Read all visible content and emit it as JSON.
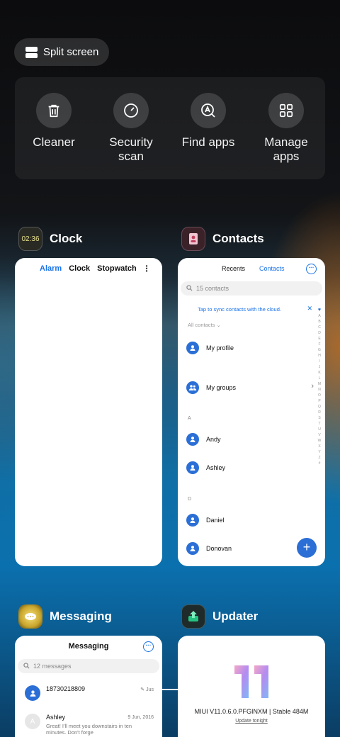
{
  "split_screen": {
    "label": "Split screen"
  },
  "quick_actions": [
    {
      "label": "Cleaner",
      "icon": "trash-icon"
    },
    {
      "label": "Security\nscan",
      "icon": "security-scan-icon"
    },
    {
      "label": "Find apps",
      "icon": "find-apps-icon"
    },
    {
      "label": "Manage\napps",
      "icon": "grid-icon"
    }
  ],
  "apps": {
    "clock": {
      "title": "Clock",
      "icon_text": "02:36",
      "tabs": [
        "Alarm",
        "Clock",
        "Stopwatch"
      ],
      "active_tab": "Alarm"
    },
    "contacts": {
      "title": "Contacts",
      "tabs": [
        "Recents",
        "Contacts"
      ],
      "active_tab": "Contacts",
      "search_placeholder": "15 contacts",
      "sync_notice": "Tap to sync contacts with the cloud.",
      "filter": "All contacts",
      "my_profile": "My profile",
      "my_groups": "My groups",
      "sections": [
        {
          "letter": "A",
          "names": [
            "Andy",
            "Ashley"
          ]
        },
        {
          "letter": "D",
          "names": [
            "Daniel",
            "Donovan"
          ]
        }
      ],
      "alphabet": "ABCDEFGHIJKLMNOPQRSTUVWXYZ#"
    },
    "messaging": {
      "title": "Messaging",
      "header": "Messaging",
      "search_placeholder": "12 messages",
      "threads": [
        {
          "name": "18730218809",
          "date": "Jus",
          "snippet": ""
        },
        {
          "name": "Ashley",
          "avatar_letter": "A",
          "date": "9 Jun, 2016",
          "snippet": "Great! I'll meet you downstairs in ten minutes. Don't forge"
        }
      ]
    },
    "updater": {
      "title": "Updater",
      "version": "MIUI V11.0.6.0.PFGINXM | Stable 484M",
      "action": "Update tonight"
    }
  },
  "colors": {
    "accent_blue": "#1a73e8",
    "fab_blue": "#2b6fd6",
    "miui_gradient": [
      "#f3a6c8",
      "#b58cf0",
      "#7fb8f5"
    ],
    "updater_green": "#26c281"
  }
}
